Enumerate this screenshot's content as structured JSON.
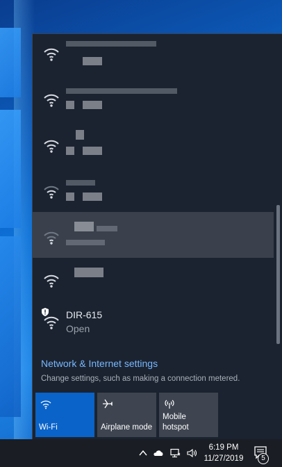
{
  "networks": [
    {
      "name": "",
      "status": "",
      "secured": true,
      "highlighted": false
    },
    {
      "name": "",
      "status": "",
      "secured": true,
      "highlighted": false
    },
    {
      "name": "",
      "status": "",
      "secured": true,
      "highlighted": false
    },
    {
      "name": "",
      "status": "",
      "secured": true,
      "highlighted": false
    },
    {
      "name": "",
      "status": "",
      "secured": true,
      "highlighted": true
    },
    {
      "name": "",
      "status": "",
      "secured": true,
      "highlighted": false
    },
    {
      "name": "DIR-615",
      "status": "Open",
      "secured": false,
      "highlighted": false
    }
  ],
  "settings": {
    "link": "Network & Internet settings",
    "description": "Change settings, such as making a connection metered."
  },
  "quick_actions": [
    {
      "label": "Wi-Fi",
      "icon": "wifi-icon",
      "active": true
    },
    {
      "label": "Airplane mode",
      "icon": "airplane-icon",
      "active": false
    },
    {
      "label": "Mobile\nhotspot",
      "icon": "hotspot-icon",
      "active": false
    }
  ],
  "taskbar": {
    "time": "6:19 PM",
    "date": "11/27/2019",
    "notification_count": "5"
  },
  "colors": {
    "accent": "#0a63c9",
    "link": "#78b8ff",
    "flyout_bg": "#1b2330"
  }
}
